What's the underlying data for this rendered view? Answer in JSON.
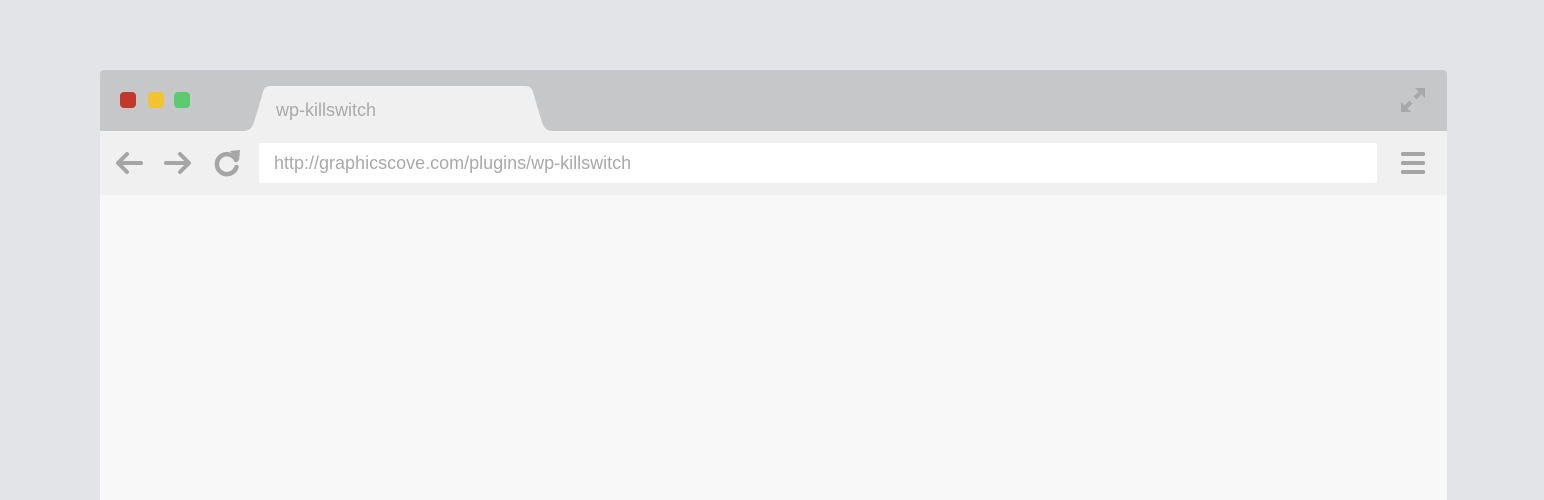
{
  "window": {
    "traffic_lights": {
      "close_color": "#c0392b",
      "minimize_color": "#f1c232",
      "maximize_color": "#5ccb6f"
    }
  },
  "tab": {
    "label": "wp-killswitch"
  },
  "toolbar": {
    "url": "http://graphicscove.com/plugins/wp-killswitch",
    "icons": {
      "back": "arrow-left-icon",
      "forward": "arrow-right-icon",
      "reload": "reload-icon",
      "menu": "hamburger-menu-icon",
      "fullscreen": "expand-icon"
    }
  }
}
